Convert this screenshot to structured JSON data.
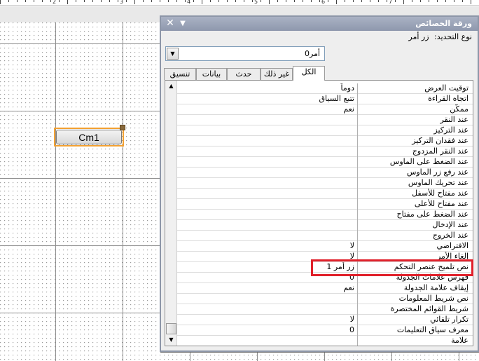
{
  "ruler": {
    "numbers": [
      "2",
      "3",
      "4",
      "5",
      "6",
      "7"
    ]
  },
  "design": {
    "command_button_label": "Cm1"
  },
  "sheet": {
    "title": "ورقة الخصائص",
    "close_icon": "close-icon",
    "menu_icon": "chevron-down-icon",
    "selection_type_label": "نوع التحديد:",
    "selection_type_value": "زر أمر",
    "object_dropdown_value": "أمر0",
    "tabs": [
      "الكل",
      "غير ذلك",
      "حدث",
      "بيانات",
      "تنسيق"
    ],
    "active_tab": "الكل"
  },
  "properties": [
    {
      "name": "توقيت العرض",
      "value": "دوماً"
    },
    {
      "name": "اتجاه القراءة",
      "value": "تتبع السياق"
    },
    {
      "name": "ممكّن",
      "value": "نعم"
    },
    {
      "name": "عند النقر",
      "value": ""
    },
    {
      "name": "عند التركيز",
      "value": ""
    },
    {
      "name": "عند فقدان التركيز",
      "value": ""
    },
    {
      "name": "عند النقر المزدوج",
      "value": ""
    },
    {
      "name": "عند الضغط على الماوس",
      "value": ""
    },
    {
      "name": "عند رفع زر الماوس",
      "value": ""
    },
    {
      "name": "عند تحريك الماوس",
      "value": ""
    },
    {
      "name": "عند مفتاح للأسفل",
      "value": ""
    },
    {
      "name": "عند مفتاح للأعلى",
      "value": ""
    },
    {
      "name": "عند الضغط على مفتاح",
      "value": ""
    },
    {
      "name": "عند الإدخال",
      "value": ""
    },
    {
      "name": "عند الخروج",
      "value": ""
    },
    {
      "name": "الافتراضي",
      "value": "لا"
    },
    {
      "name": "إلغاء الأمر",
      "value": "لا"
    },
    {
      "name": "نص تلميح عنصر التحكم",
      "value": "زر أمر 1"
    },
    {
      "name": "فهرس علامات الجدولة",
      "value": "0"
    },
    {
      "name": "إيقاف علامة الجدولة",
      "value": "نعم"
    },
    {
      "name": "نص شريط المعلومات",
      "value": ""
    },
    {
      "name": "شريط القوائم المختصرة",
      "value": ""
    },
    {
      "name": "تكرار تلقائي",
      "value": "لا"
    },
    {
      "name": "معرف سياق التعليمات",
      "value": "0"
    },
    {
      "name": "علامة",
      "value": ""
    }
  ],
  "colors": {
    "highlight": "#e0202a",
    "selection_border": "#f4a233",
    "titlebar": "#8e98ad"
  }
}
